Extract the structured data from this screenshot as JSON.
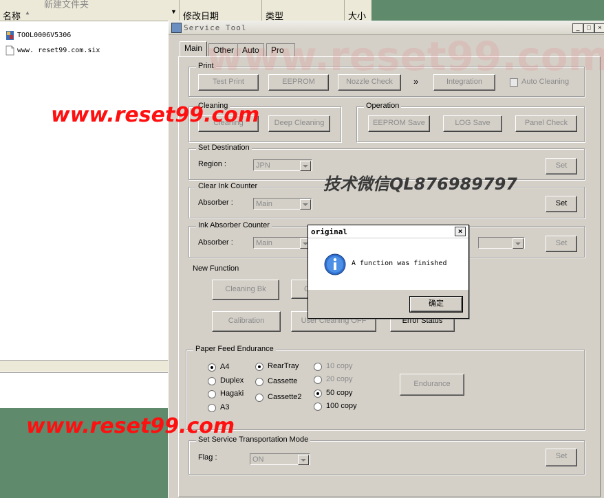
{
  "explorer": {
    "header_name": "名称",
    "header_extra": "新建文件夹",
    "header_date": "修改日期",
    "header_type": "类型",
    "header_size": "大小",
    "files": [
      {
        "name": "TOOL0006V5306",
        "icon": "exe-icon"
      },
      {
        "name": "www. reset99.com.six",
        "icon": "document-icon"
      }
    ]
  },
  "window": {
    "title": "Service Tool",
    "tabs": [
      "Main",
      "Other",
      "Auto",
      "Pro"
    ],
    "active_tab": "Main"
  },
  "print_group": {
    "caption": "Print",
    "buttons": [
      "Test Print",
      "EEPROM",
      "Nozzle Check",
      "Integration"
    ],
    "arrow": "»",
    "auto_cleaning": "Auto Cleaning"
  },
  "cleaning_group": {
    "caption": "Cleaning",
    "buttons": [
      "Cleaning",
      "Deep Cleaning"
    ]
  },
  "operation_group": {
    "caption": "Operation",
    "buttons": [
      "EEPROM Save",
      "LOG Save",
      "Panel Check"
    ]
  },
  "destination_group": {
    "caption": "Set Destination",
    "label": "Region :",
    "value": "JPN",
    "set": "Set"
  },
  "clear_ink_group": {
    "caption": "Clear Ink Counter",
    "label": "Absorber :",
    "value": "Main",
    "set": "Set"
  },
  "ink_absorber_group": {
    "caption": "Ink Absorber Counter",
    "label": "Absorber :",
    "value": "Main",
    "set": "Set"
  },
  "new_function": {
    "caption": "New Function",
    "buttons": [
      "Cleaning Bk",
      "Cl",
      "Calibration",
      "User Cleaning OFF",
      "Error Status"
    ]
  },
  "paper_feed": {
    "caption": "Paper Feed Endurance",
    "sizes": [
      "A4",
      "Duplex",
      "Hagaki",
      "A3"
    ],
    "trays": [
      "RearTray",
      "Cassette",
      "Cassette2"
    ],
    "copies": [
      "10 copy",
      "20 copy",
      "50 copy",
      "100 copy"
    ],
    "selected_size": "A4",
    "selected_tray": "RearTray",
    "selected_copy": "50 copy",
    "button": "Endurance"
  },
  "transport_group": {
    "caption": "Set Service Transportation Mode",
    "label": "Flag :",
    "value": "ON",
    "set": "Set"
  },
  "dialog": {
    "title": "original",
    "message": "A function was finished",
    "ok": "确定"
  },
  "watermarks": {
    "bg": "www.reset99.com",
    "top_left": "www.reset99.com",
    "wechat": "技术微信QL876989797",
    "bottom_left": "www.reset99.com"
  },
  "colors": {
    "watermark_red": "#ff1010",
    "window_face": "#d4d0c8",
    "disabled_text": "#8a8a8a",
    "desktop_green": "#5f8a6c"
  }
}
